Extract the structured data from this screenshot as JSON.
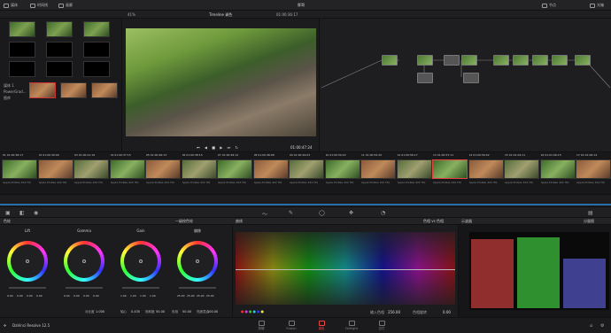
{
  "topbar": {
    "media": "媒体",
    "timeline": "时间线",
    "gallery": "画廊",
    "project_title": "胖哥",
    "nodes": "节点",
    "lightbox": "光箱"
  },
  "viewer": {
    "zoom": "41%",
    "title": "Timeline 调色",
    "timecode": "01:00:36:17",
    "playhead_tc": "01:00:47:24"
  },
  "media": {
    "folders": [
      "媒体 1",
      "PowerGrad...",
      "图库"
    ]
  },
  "clips": [
    {
      "num": "01",
      "tc": "01:00:36:17",
      "label": "Apple ProRes 422 HQ"
    },
    {
      "num": "02",
      "tc": "01:00:39:09",
      "label": "Apple ProRes 422 HQ"
    },
    {
      "num": "03",
      "tc": "01:00:21:16",
      "label": "Apple ProRes 422 HQ"
    },
    {
      "num": "04",
      "tc": "01:00:37:15",
      "label": "Apple ProRes 422 HQ"
    },
    {
      "num": "05",
      "tc": "01:00:46:13",
      "label": "Apple ProRes 422 HQ"
    },
    {
      "num": "06",
      "tc": "01:00:38:15",
      "label": "Apple ProRes 422 HQ"
    },
    {
      "num": "07",
      "tc": "01:00:49:12",
      "label": "Apple ProRes 422 HQ"
    },
    {
      "num": "08",
      "tc": "01:00:48:08",
      "label": "Apple ProRes 422 HQ"
    },
    {
      "num": "09",
      "tc": "01:00:49:03",
      "label": "Apple ProRes 422 HQ"
    },
    {
      "num": "10",
      "tc": "01:00:50:22",
      "label": "Apple ProRes 422 HQ"
    },
    {
      "num": "11",
      "tc": "01:00:52:20",
      "label": "Apple ProRes 422 HQ"
    },
    {
      "num": "12",
      "tc": "01:00:56:17",
      "label": "Apple ProRes 422 HQ"
    },
    {
      "num": "13",
      "tc": "01:00:57:11",
      "label": "Apple ProRes 422 HQ"
    },
    {
      "num": "14",
      "tc": "01:00:59:02",
      "label": "Apple ProRes 422 HQ"
    },
    {
      "num": "15",
      "tc": "01:01:04:11",
      "label": "Apple ProRes 422 HQ"
    },
    {
      "num": "16",
      "tc": "01:01:06:15",
      "label": "Apple ProRes 422 HQ"
    },
    {
      "num": "17",
      "tc": "01:01:06:14",
      "label": "Apple ProRes 422 HQ"
    }
  ],
  "panels": {
    "wheels_title": "色轮",
    "wheels_mode": "一级校色轮",
    "curves_title": "曲线",
    "curves_mode": "色相 vs 色相",
    "scope_title": "示波器",
    "scope_mode": "分量图"
  },
  "wheels": [
    {
      "name": "Lift",
      "values": [
        "0.00",
        "0.00",
        "0.00",
        "0.00"
      ]
    },
    {
      "name": "Gamma",
      "values": [
        "0.00",
        "0.00",
        "0.00",
        "0.00"
      ]
    },
    {
      "name": "Gain",
      "values": [
        "1.00",
        "1.00",
        "1.00",
        "1.00"
      ]
    },
    {
      "name": "偏移",
      "values": [
        "25.00",
        "25.00",
        "25.00",
        "25.00"
      ]
    }
  ],
  "wheel_footer": {
    "contrast_label": "对比度",
    "contrast": "1.000",
    "pivot_label": "轴心",
    "pivot": "0.435",
    "sat_label": "饱和度",
    "sat": "50.00",
    "hue_label": "色相",
    "hue": "50.00",
    "lum_label": "亮度混合",
    "lum": "100.00"
  },
  "curves_footer": {
    "input_label": "输入色相",
    "input": "256.00",
    "rot_label": "色相旋转",
    "rot": "0.00"
  },
  "pages": [
    {
      "name": "剪辑",
      "icon": "edit-icon"
    },
    {
      "name": "Fusion",
      "icon": "fusion-icon"
    },
    {
      "name": "调色",
      "icon": "color-icon",
      "active": true
    },
    {
      "name": "Fairlight",
      "icon": "fairlight-icon"
    },
    {
      "name": "交付",
      "icon": "deliver-icon"
    }
  ],
  "app": {
    "name": "DaVinci Resolve 12.5"
  },
  "colors": {
    "accent": "#e44444",
    "bg": "#1c1c1e"
  }
}
